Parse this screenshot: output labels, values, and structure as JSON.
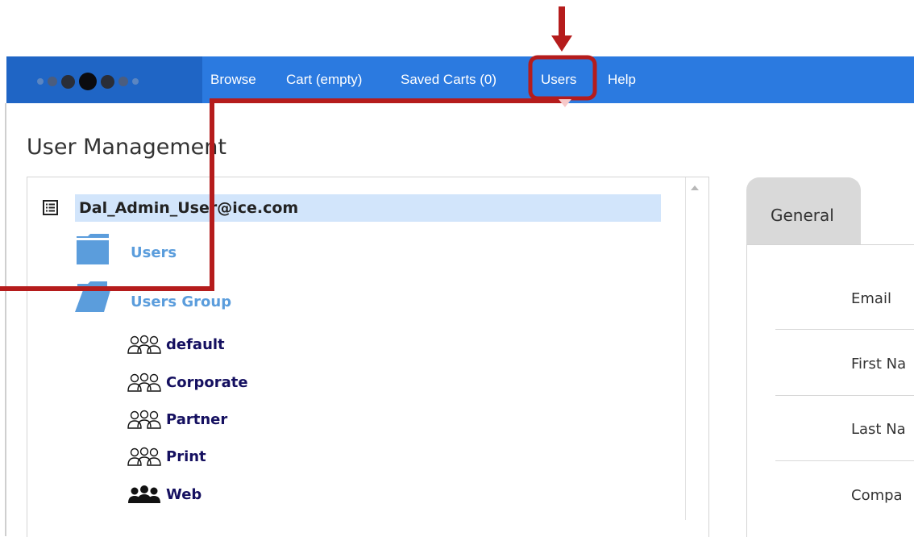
{
  "nav": {
    "links": [
      "Browse",
      "Cart (empty)",
      "Saved Carts (0)",
      "Users",
      "Help"
    ],
    "accent_color": "#2b7ae0",
    "logo_dots": [
      {
        "color": "#5b86c2"
      },
      {
        "color": "#4b5d7e"
      },
      {
        "color": "#2a2e38"
      },
      {
        "color": "#0b0b0f"
      },
      {
        "color": "#2a2e38"
      },
      {
        "color": "#4b5d7e"
      },
      {
        "color": "#5b86c2"
      }
    ]
  },
  "page": {
    "title": "User Management"
  },
  "tree": {
    "root": {
      "label": "Dal_Admin_User@ice.com",
      "icon": "list-icon"
    },
    "folders": [
      {
        "label": "Users",
        "icon": "folder-icon",
        "state": "closed"
      },
      {
        "label": "Users Group",
        "icon": "folder-open-icon",
        "state": "open"
      }
    ],
    "groups": [
      {
        "label": "default",
        "icon": "group-outline-icon"
      },
      {
        "label": "Corporate",
        "icon": "group-outline-icon"
      },
      {
        "label": "Partner",
        "icon": "group-outline-icon"
      },
      {
        "label": "Print",
        "icon": "group-outline-icon"
      },
      {
        "label": "Web",
        "icon": "group-filled-icon"
      }
    ]
  },
  "details": {
    "tab": "General",
    "fields": [
      "Email",
      "First Na",
      "Last Na",
      "Compa"
    ]
  },
  "annotation": {
    "color": "#b51c1c",
    "highlight_target": "Users"
  }
}
